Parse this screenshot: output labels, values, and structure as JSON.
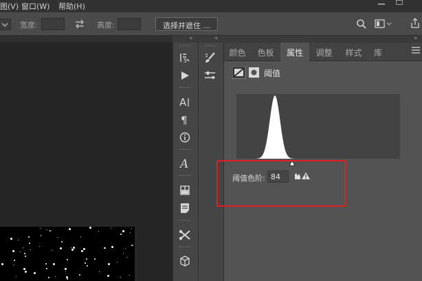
{
  "menubar": {
    "items": [
      "图(V)",
      "窗口(W)",
      "帮助(H)"
    ]
  },
  "options": {
    "width_label": "宽度:",
    "height_label": "高度:",
    "select_mask_button": "选择并遮住 ..."
  },
  "tools": {
    "strip1": [
      "history-brush-icon",
      "play-icon",
      "character-icon",
      "paragraph-icon",
      "info-icon",
      "glyphs-icon",
      "layout-icon",
      "notes-icon",
      "tool-presets-icon",
      "3d-icon"
    ],
    "strip2": [
      "brush-icon",
      "brush-settings-icon"
    ]
  },
  "properties": {
    "tabs": [
      "颜色",
      "色板",
      "属性",
      "调整",
      "样式",
      "库"
    ],
    "active_tab": "属性",
    "panel_title": "阈值",
    "threshold_label": "阈值色阶:",
    "threshold_value": "84"
  },
  "colors": {
    "highlight": "#e02020",
    "panel_bg": "#535353",
    "histogram_bg": "#434343"
  }
}
